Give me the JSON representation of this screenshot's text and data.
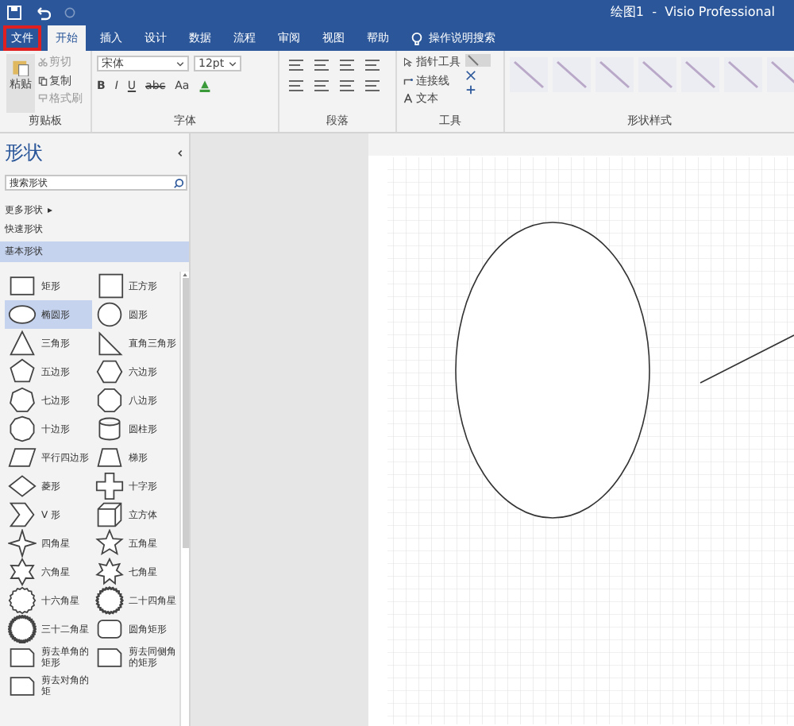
{
  "window": {
    "title": "绘图1  -  Visio Professional"
  },
  "ribbon_tabs": [
    {
      "label": "文件",
      "selected": false,
      "highlighted": true
    },
    {
      "label": "开始",
      "selected": true,
      "highlighted": false
    },
    {
      "label": "插入",
      "selected": false,
      "highlighted": false
    },
    {
      "label": "设计",
      "selected": false,
      "highlighted": false
    },
    {
      "label": "数据",
      "selected": false,
      "highlighted": false
    },
    {
      "label": "流程",
      "selected": false,
      "highlighted": false
    },
    {
      "label": "审阅",
      "selected": false,
      "highlighted": false
    },
    {
      "label": "视图",
      "selected": false,
      "highlighted": false
    },
    {
      "label": "帮助",
      "selected": false,
      "highlighted": false
    }
  ],
  "tell_me": "操作说明搜索",
  "clipboard": {
    "paste": "粘贴",
    "cut": "剪切",
    "copy": "复制",
    "format_painter": "格式刷",
    "group": "剪贴板"
  },
  "font": {
    "name": "宋体",
    "size": "12pt",
    "bold": "B",
    "italic": "I",
    "underline": "U",
    "strike": "abc",
    "case": "Aa",
    "group": "字体"
  },
  "paragraph": {
    "group": "段落"
  },
  "tools": {
    "pointer": "指针工具",
    "connector": "连接线",
    "text": "文本",
    "group": "工具"
  },
  "shape_styles": {
    "group": "形状样式"
  },
  "shapes_pane": {
    "title": "形状",
    "search_placeholder": "搜索形状",
    "more": "更多形状",
    "quick": "快速形状",
    "basic": "基本形状",
    "items": [
      {
        "label": "矩形",
        "kind": "rect",
        "selected": false
      },
      {
        "label": "正方形",
        "kind": "square",
        "selected": false
      },
      {
        "label": "椭圆形",
        "kind": "ellipse",
        "selected": true
      },
      {
        "label": "圆形",
        "kind": "circle",
        "selected": false
      },
      {
        "label": "三角形",
        "kind": "triangle",
        "selected": false
      },
      {
        "label": "直角三角形",
        "kind": "right-triangle",
        "selected": false
      },
      {
        "label": "五边形",
        "kind": "pentagon",
        "selected": false
      },
      {
        "label": "六边形",
        "kind": "hexagon",
        "selected": false
      },
      {
        "label": "七边形",
        "kind": "heptagon",
        "selected": false
      },
      {
        "label": "八边形",
        "kind": "octagon",
        "selected": false
      },
      {
        "label": "十边形",
        "kind": "decagon",
        "selected": false
      },
      {
        "label": "圆柱形",
        "kind": "cylinder",
        "selected": false
      },
      {
        "label": "平行四边形",
        "kind": "parallelogram",
        "selected": false
      },
      {
        "label": "梯形",
        "kind": "trapezoid",
        "selected": false
      },
      {
        "label": "菱形",
        "kind": "diamond",
        "selected": false
      },
      {
        "label": "十字形",
        "kind": "cross",
        "selected": false
      },
      {
        "label": "V 形",
        "kind": "chevron",
        "selected": false
      },
      {
        "label": "立方体",
        "kind": "cube",
        "selected": false
      },
      {
        "label": "四角星",
        "kind": "star4",
        "selected": false
      },
      {
        "label": "五角星",
        "kind": "star5",
        "selected": false
      },
      {
        "label": "六角星",
        "kind": "star6",
        "selected": false
      },
      {
        "label": "七角星",
        "kind": "star7",
        "selected": false
      },
      {
        "label": "十六角星",
        "kind": "star16",
        "selected": false
      },
      {
        "label": "二十四角星",
        "kind": "star24",
        "selected": false
      },
      {
        "label": "三十二角星",
        "kind": "star32",
        "selected": false
      },
      {
        "label": "圆角矩形",
        "kind": "rounded-rect",
        "selected": false
      },
      {
        "label": "剪去单角的矩形",
        "kind": "snip",
        "selected": false
      },
      {
        "label": "剪去同侧角的矩形",
        "kind": "snip",
        "selected": false
      },
      {
        "label": "剪去对角的矩",
        "kind": "snip",
        "selected": false
      }
    ]
  }
}
